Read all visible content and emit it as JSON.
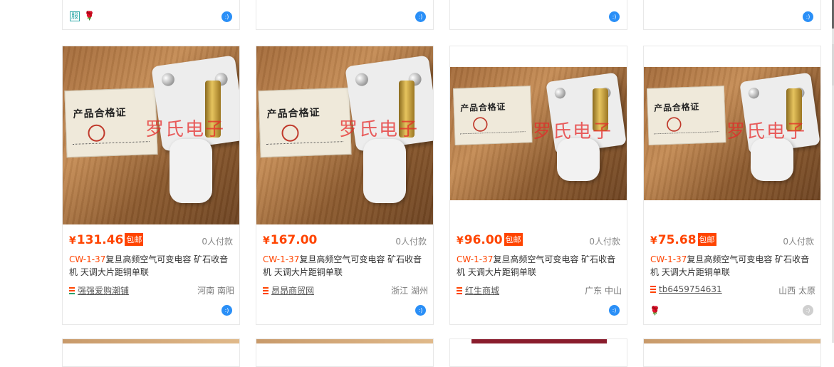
{
  "top_row": [
    {
      "badges": [
        "服",
        "🌹"
      ],
      "wangwang": "online"
    },
    {
      "badges": [],
      "wangwang": "online"
    },
    {
      "badges": [],
      "wangwang": "online"
    },
    {
      "badges": [],
      "wangwang": "online"
    }
  ],
  "products": [
    {
      "price_symbol": "¥",
      "price": "131.46",
      "tag": "包邮",
      "sold": "0人付款",
      "title_highlight": "CW-1-37",
      "title_rest": "复旦高频空气可变电容 矿石收音机 天调大片距铜单联",
      "shop": "强强爱购潮铺",
      "location": "河南 南阳",
      "watermark": "罗氏电子",
      "cert_title": "产品合格证",
      "wangwang": "online"
    },
    {
      "price_symbol": "¥",
      "price": "167.00",
      "tag": "",
      "sold": "0人付款",
      "title_highlight": "CW-1-37",
      "title_rest": "复旦高频空气可变电容 矿石收音机 天调大片距铜单联",
      "shop": "昂昂商贸网",
      "location": "浙江 湖州",
      "watermark": "罗氏电子",
      "cert_title": "产品合格证",
      "wangwang": "online"
    },
    {
      "price_symbol": "¥",
      "price": "96.00",
      "tag": "包邮",
      "sold": "0人付款",
      "title_highlight": "CW-1-37",
      "title_rest": "复旦高频空气可变电容 矿石收音机 天调大片距铜单联",
      "shop": "红生商城",
      "location": "广东 中山",
      "watermark": "罗氏电子",
      "cert_title": "产品合格证",
      "wangwang": "online"
    },
    {
      "price_symbol": "¥",
      "price": "75.68",
      "tag": "包邮",
      "sold": "0人付款",
      "title_highlight": "CW-1-37",
      "title_rest": "复旦高频空气可变电容 矿石收音机 天调大片距铜单联",
      "shop": "tb6459754631",
      "location": "山西 太原",
      "watermark": "罗氏电子",
      "cert_title": "产品合格证",
      "wangwang": "offline",
      "badge": "🌹"
    }
  ],
  "colors": {
    "accent": "#ff4400",
    "wangwang_online": "#2a8ff7",
    "wangwang_offline": "#cfcfcf",
    "card_border": "#e8e8e8"
  },
  "icons": {
    "wangwang": "wangwang-chat-icon",
    "shop": "shop-level-icon"
  }
}
